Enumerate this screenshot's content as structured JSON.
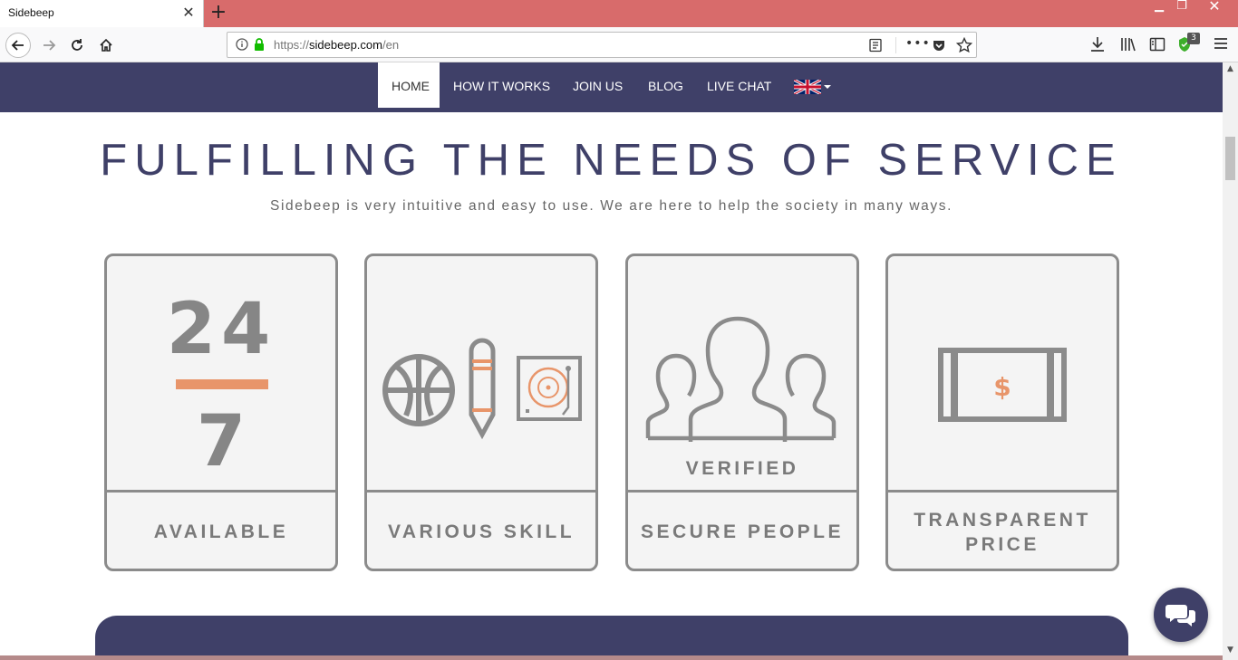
{
  "browser": {
    "tab_title": "Sidebeep",
    "tab_close": "✕",
    "new_tab": "+",
    "window_controls": {
      "minimize": "▁",
      "maximize": "❐",
      "close": "✕"
    },
    "url": {
      "scheme": "https://",
      "host": "sidebeep.com",
      "path": "/en"
    },
    "more": "•••",
    "extension_badge": "3"
  },
  "site": {
    "nav": {
      "items": [
        {
          "label": "HOME",
          "active": true
        },
        {
          "label": "HOW IT WORKS"
        },
        {
          "label": "JOIN US"
        },
        {
          "label": "BLOG"
        },
        {
          "label": "LIVE CHAT"
        }
      ],
      "language_flag": "uk-flag-icon"
    },
    "hero": {
      "title": "FULFILLING THE NEEDS OF SERVICE",
      "subtitle": "Sidebeep is very intuitive and easy to use. We are here to help the society in many ways."
    },
    "features": [
      {
        "label": "AVAILABLE",
        "icon": "24-7-icon",
        "top": "24",
        "bottom": "7"
      },
      {
        "label": "VARIOUS SKILL",
        "icon": "skills-icon"
      },
      {
        "label": "SECURE PEOPLE",
        "icon": "people-icon",
        "badge": "VERIFIED"
      },
      {
        "label": "TRANSPARENT PRICE",
        "icon": "price-tag-icon",
        "symbol": "$"
      }
    ],
    "colors": {
      "primary": "#3f4068",
      "accent": "#e8956a",
      "icon_gray": "#8b8b8b"
    }
  }
}
